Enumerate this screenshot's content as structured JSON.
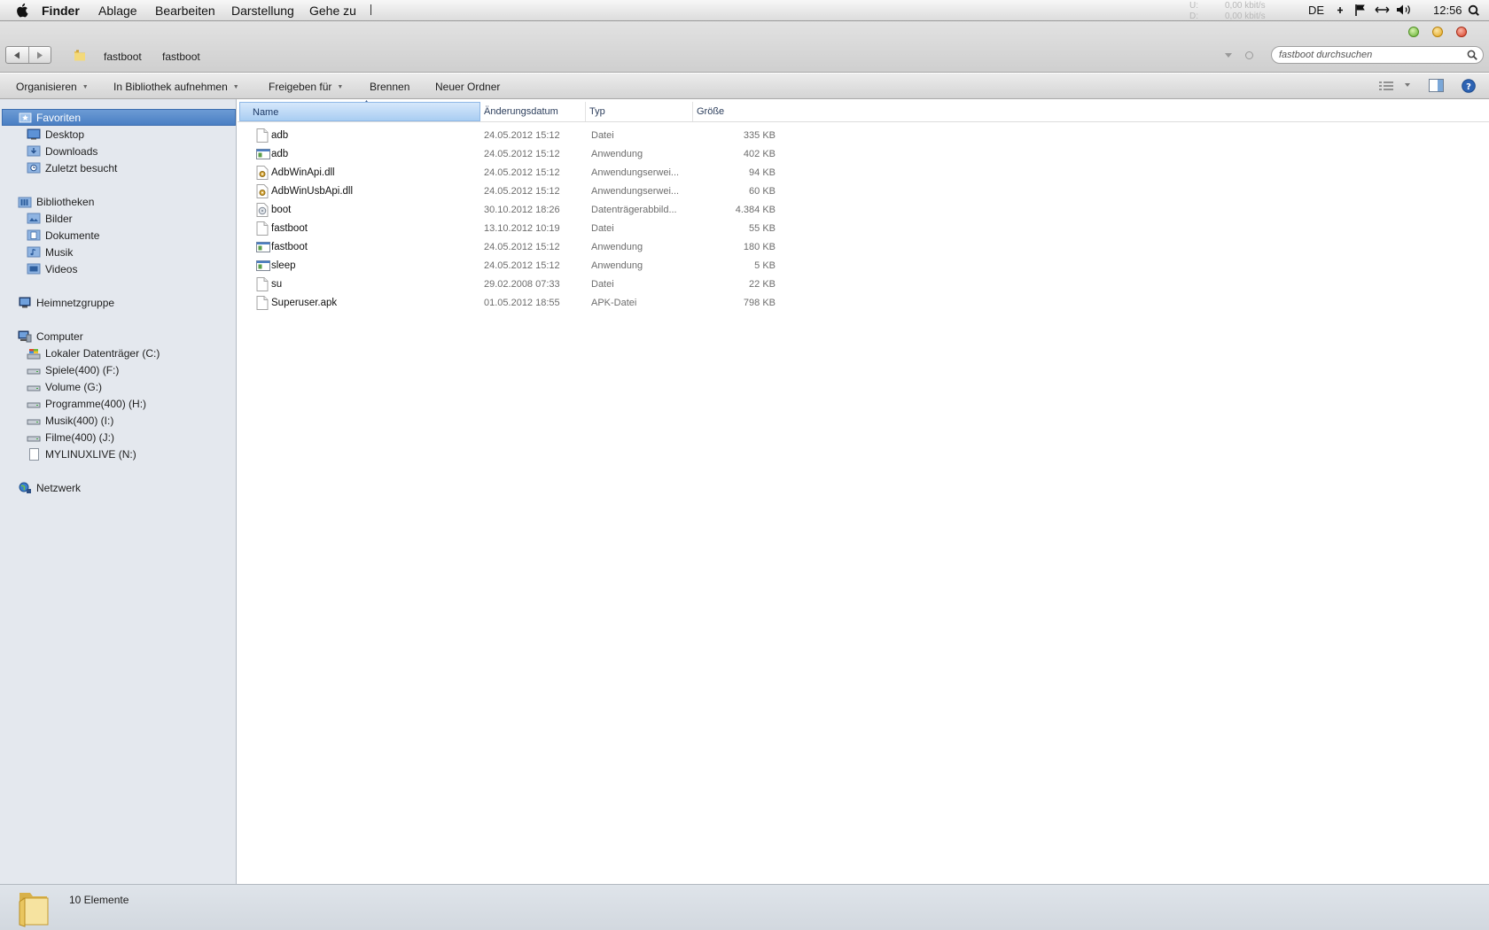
{
  "menubar": {
    "app": "Finder",
    "items": [
      "Ablage",
      "Bearbeiten",
      "Darstellung",
      "Gehe zu"
    ],
    "net_up_label": "U:",
    "net_up_value": "0,00 kbit/s",
    "net_down_label": "D:",
    "net_down_value": "0,00 kbit/s",
    "input_language": "DE",
    "clock": "12:56"
  },
  "address": {
    "crumbs": [
      "fastboot",
      "fastboot"
    ],
    "search_placeholder": "fastboot durchsuchen"
  },
  "commandbar": {
    "organize": "Organisieren",
    "add_to_library": "In Bibliothek aufnehmen",
    "share_with": "Freigeben für",
    "burn": "Brennen",
    "new_folder": "Neuer Ordner"
  },
  "sidebar": {
    "favorites": "Favoriten",
    "favorites_items": [
      "Desktop",
      "Downloads",
      "Zuletzt besucht"
    ],
    "libraries": "Bibliotheken",
    "library_items": [
      "Bilder",
      "Dokumente",
      "Musik",
      "Videos"
    ],
    "homegroup": "Heimnetzgruppe",
    "computer": "Computer",
    "drives": [
      "Lokaler Datenträger (C:)",
      "Spiele(400) (F:)",
      "Volume (G:)",
      "Programme(400) (H:)",
      "Musik(400) (I:)",
      "Filme(400) (J:)",
      "MYLINUXLIVE (N:)"
    ],
    "network": "Netzwerk"
  },
  "columns": {
    "name": "Name",
    "date": "Änderungsdatum",
    "type": "Typ",
    "size": "Größe"
  },
  "files": [
    {
      "name": "adb",
      "date": "24.05.2012 15:12",
      "type": "Datei",
      "size": "335 KB",
      "icon": "file-icon"
    },
    {
      "name": "adb",
      "date": "24.05.2012 15:12",
      "type": "Anwendung",
      "size": "402 KB",
      "icon": "exe-icon"
    },
    {
      "name": "AdbWinApi.dll",
      "date": "24.05.2012 15:12",
      "type": "Anwendungserwei...",
      "size": "94 KB",
      "icon": "dll-icon"
    },
    {
      "name": "AdbWinUsbApi.dll",
      "date": "24.05.2012 15:12",
      "type": "Anwendungserwei...",
      "size": "60 KB",
      "icon": "dll-icon"
    },
    {
      "name": "boot",
      "date": "30.10.2012 18:26",
      "type": "Datenträgerabbild...",
      "size": "4.384 KB",
      "icon": "disk-image-icon"
    },
    {
      "name": "fastboot",
      "date": "13.10.2012 10:19",
      "type": "Datei",
      "size": "55 KB",
      "icon": "file-icon"
    },
    {
      "name": "fastboot",
      "date": "24.05.2012 15:12",
      "type": "Anwendung",
      "size": "180 KB",
      "icon": "exe-icon"
    },
    {
      "name": "sleep",
      "date": "24.05.2012 15:12",
      "type": "Anwendung",
      "size": "5 KB",
      "icon": "exe-icon"
    },
    {
      "name": "su",
      "date": "29.02.2008 07:33",
      "type": "Datei",
      "size": "22 KB",
      "icon": "file-icon"
    },
    {
      "name": "Superuser.apk",
      "date": "01.05.2012 18:55",
      "type": "APK-Datei",
      "size": "798 KB",
      "icon": "file-icon"
    }
  ],
  "status": {
    "item_count": "10 Elemente"
  }
}
